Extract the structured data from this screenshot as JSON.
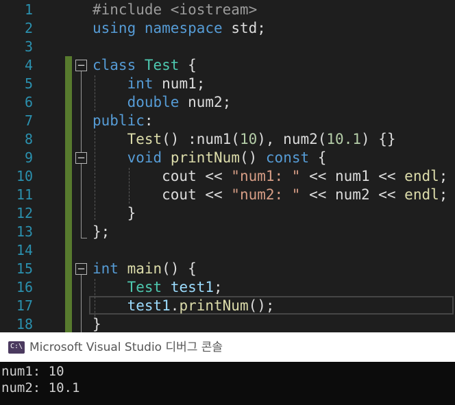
{
  "colors": {
    "background": "#1e1e1e",
    "line_number": "#2b91af",
    "keyword": "#569cd6",
    "type": "#4ec9b0",
    "function": "#dcdcaa",
    "string": "#d69d85",
    "number": "#b5cea8",
    "variable": "#9cdcfe",
    "plain": "#dcdcdc",
    "preprocessor": "#9b9b9b",
    "change_bar": "#577a2e",
    "console_bg": "#0c0c0c"
  },
  "editor": {
    "lines": [
      {
        "num": "1",
        "tokens": [
          {
            "t": "#include <iostream>",
            "c": "preprocessor"
          }
        ]
      },
      {
        "num": "2",
        "tokens": [
          {
            "t": "using",
            "c": "keyword"
          },
          {
            "t": " "
          },
          {
            "t": "namespace",
            "c": "keyword"
          },
          {
            "t": " std;"
          }
        ]
      },
      {
        "num": "3",
        "tokens": []
      },
      {
        "num": "4",
        "tokens": [
          {
            "t": "class",
            "c": "keyword"
          },
          {
            "t": " "
          },
          {
            "t": "Test",
            "c": "type"
          },
          {
            "t": " {"
          }
        ]
      },
      {
        "num": "5",
        "tokens": [
          {
            "t": "    "
          },
          {
            "t": "int",
            "c": "keyword"
          },
          {
            "t": " num1;"
          }
        ]
      },
      {
        "num": "6",
        "tokens": [
          {
            "t": "    "
          },
          {
            "t": "double",
            "c": "keyword"
          },
          {
            "t": " num2;"
          }
        ]
      },
      {
        "num": "7",
        "tokens": [
          {
            "t": "public",
            "c": "keyword"
          },
          {
            "t": ":"
          }
        ]
      },
      {
        "num": "8",
        "tokens": [
          {
            "t": "    "
          },
          {
            "t": "Test",
            "c": "function"
          },
          {
            "t": "() :num1("
          },
          {
            "t": "10",
            "c": "number"
          },
          {
            "t": "), num2("
          },
          {
            "t": "10.1",
            "c": "number"
          },
          {
            "t": ") {}"
          }
        ]
      },
      {
        "num": "9",
        "tokens": [
          {
            "t": "    "
          },
          {
            "t": "void",
            "c": "keyword"
          },
          {
            "t": " "
          },
          {
            "t": "printNum",
            "c": "function"
          },
          {
            "t": "() "
          },
          {
            "t": "const",
            "c": "keyword"
          },
          {
            "t": " {"
          }
        ]
      },
      {
        "num": "10",
        "tokens": [
          {
            "t": "        cout << "
          },
          {
            "t": "\"num1: \"",
            "c": "string"
          },
          {
            "t": " << num1 << "
          },
          {
            "t": "endl",
            "c": "function"
          },
          {
            "t": ";"
          }
        ]
      },
      {
        "num": "11",
        "tokens": [
          {
            "t": "        cout << "
          },
          {
            "t": "\"num2: \"",
            "c": "string"
          },
          {
            "t": " << num2 << "
          },
          {
            "t": "endl",
            "c": "function"
          },
          {
            "t": ";"
          }
        ]
      },
      {
        "num": "12",
        "tokens": [
          {
            "t": "    }"
          }
        ]
      },
      {
        "num": "13",
        "tokens": [
          {
            "t": "};"
          }
        ]
      },
      {
        "num": "14",
        "tokens": []
      },
      {
        "num": "15",
        "tokens": [
          {
            "t": "int",
            "c": "keyword"
          },
          {
            "t": " "
          },
          {
            "t": "main",
            "c": "function"
          },
          {
            "t": "() {"
          }
        ]
      },
      {
        "num": "16",
        "tokens": [
          {
            "t": "    "
          },
          {
            "t": "Test",
            "c": "type"
          },
          {
            "t": " "
          },
          {
            "t": "test1",
            "c": "variable"
          },
          {
            "t": ";"
          }
        ]
      },
      {
        "num": "17",
        "tokens": [
          {
            "t": "    "
          },
          {
            "t": "test1",
            "c": "variable"
          },
          {
            "t": "."
          },
          {
            "t": "printNum",
            "c": "function"
          },
          {
            "t": "();"
          }
        ]
      },
      {
        "num": "18",
        "tokens": [
          {
            "t": "}"
          }
        ]
      }
    ],
    "fold_glyph": "−"
  },
  "console": {
    "icon_label": "C:\\",
    "title": "Microsoft Visual Studio 디버그 콘솔",
    "output": [
      "num1: 10",
      "num2: 10.1"
    ]
  }
}
